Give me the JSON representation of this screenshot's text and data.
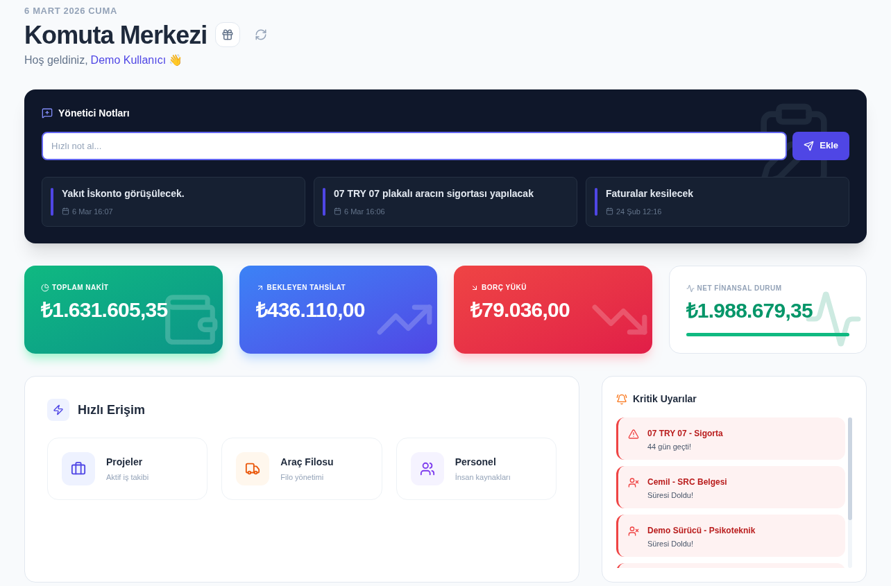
{
  "header": {
    "date": "6 MART 2026 CUMA",
    "title": "Komuta Merkezi",
    "greeting": "Hoş geldiniz,",
    "user": "Demo Kullanıcı",
    "emoji": "👋"
  },
  "notes": {
    "title": "Yönetici Notları",
    "input": {
      "placeholder": "Hızlı not al..."
    },
    "add_button": "Ekle",
    "items": [
      {
        "text": "Yakıt İskonto görüşülecek.",
        "date": "6 Mar 16:07"
      },
      {
        "text": "07 TRY 07 plakalı aracın sigortası yapılacak",
        "date": "6 Mar 16:06"
      },
      {
        "text": "Faturalar kesilecek",
        "date": "24 Şub 12:16"
      }
    ]
  },
  "stats": [
    {
      "kind": "cash",
      "label": "TOPLAM NAKİT",
      "value": "₺1.631.605,35"
    },
    {
      "kind": "receivable",
      "label": "BEKLEYEN TAHSİLAT",
      "value": "₺436.110,00"
    },
    {
      "kind": "debt",
      "label": "BORÇ YÜKÜ",
      "value": "₺79.036,00"
    },
    {
      "kind": "net",
      "label": "NET FİNANSAL DURUM",
      "value": "₺1.988.679,35",
      "level": 1
    }
  ],
  "quick_access": {
    "title": "Hızlı Erişim",
    "items": [
      {
        "kind": "projects",
        "title": "Projeler",
        "subtitle": "Aktif iş takibi"
      },
      {
        "kind": "fleet",
        "title": "Araç Filosu",
        "subtitle": "Filo yönetimi"
      },
      {
        "kind": "staff",
        "title": "Personel",
        "subtitle": "İnsan kaynakları"
      }
    ]
  },
  "alerts": {
    "title": "Kritik Uyarılar",
    "items": [
      {
        "kind": "vehicle",
        "title": "07 TRY 07 - Sigorta",
        "detail": "44 gün geçti!"
      },
      {
        "kind": "person",
        "title": "Cemil - SRC Belgesi",
        "detail": "Süresi Doldu!"
      },
      {
        "kind": "person",
        "title": "Demo Sürücü - Psikoteknik",
        "detail": "Süresi Doldu!"
      }
    ]
  }
}
